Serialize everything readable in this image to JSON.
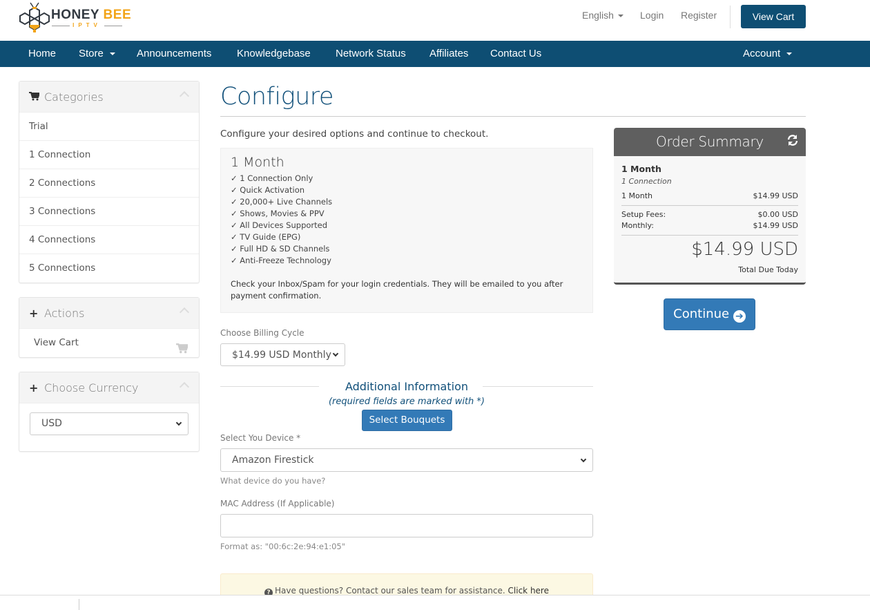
{
  "brand": {
    "name_part1": "HON",
    "name_e": "E",
    "name_part2": "Y",
    "name_bee": "BEE",
    "sub": "IPTV",
    "accent": "#f2a418",
    "primary": "#0e4e73"
  },
  "header": {
    "language": "English",
    "login": "Login",
    "register": "Register",
    "view_cart": "View Cart"
  },
  "nav": {
    "items": [
      {
        "label": "Home"
      },
      {
        "label": "Store",
        "dropdown": true
      },
      {
        "label": "Announcements"
      },
      {
        "label": "Knowledgebase"
      },
      {
        "label": "Network Status"
      },
      {
        "label": "Affiliates"
      },
      {
        "label": "Contact Us"
      }
    ],
    "account": "Account"
  },
  "sidebar": {
    "categories": {
      "title": "Categories",
      "icon": "cart-icon",
      "items": [
        "Trial",
        "1 Connection",
        "2 Connections",
        "3 Connections",
        "4 Connections",
        "5 Connections"
      ]
    },
    "actions": {
      "title": "Actions",
      "icon": "plus-icon",
      "items": [
        {
          "label": "View Cart",
          "icon": "cart-icon"
        }
      ]
    },
    "currency": {
      "title": "Choose Currency",
      "icon": "plus-icon",
      "selected": "USD"
    }
  },
  "main": {
    "title": "Configure",
    "intro": "Configure your desired options and continue to checkout.",
    "product": {
      "name": "1 Month",
      "features": [
        "✓ 1 Connection Only",
        "✓ Quick Activation",
        "✓ 20,000+ Live Channels",
        "✓ Shows, Movies & PPV",
        "✓ All Devices Supported",
        "✓ TV Guide (EPG)",
        "✓ Full HD & SD Channels",
        "✓ Anti-Freeze Technology"
      ],
      "note": "Check your Inbox/Spam for your login credentials. They will be emailed to you after payment confirmation."
    },
    "billing": {
      "label": "Choose Billing Cycle",
      "selected": "$14.99 USD Monthly"
    },
    "additional": {
      "title": "Additional Information",
      "subtitle": "(required fields are marked with *)",
      "bouquets_button": "Select Bouquets",
      "device_label": "Select You Device *",
      "device_selected": "Amazon Firestick",
      "device_help": "What device do you have?",
      "mac_label": "MAC Address (If Applicable)",
      "mac_value": "",
      "mac_help": "Format as: \"00:6c:2e:94:e1:05\""
    },
    "alert": {
      "text": "Have questions? Contact our sales team for assistance.",
      "link": "Click here"
    }
  },
  "summary": {
    "title": "Order Summary",
    "product": "1 Month",
    "group": "1 Connection",
    "line_label": "1 Month",
    "line_value": "$14.99 USD",
    "setup_label": "Setup Fees:",
    "setup_value": "$0.00 USD",
    "monthly_label": "Monthly:",
    "monthly_value": "$14.99 USD",
    "total": "$14.99 USD",
    "total_label": "Total Due Today",
    "continue": "Continue"
  }
}
